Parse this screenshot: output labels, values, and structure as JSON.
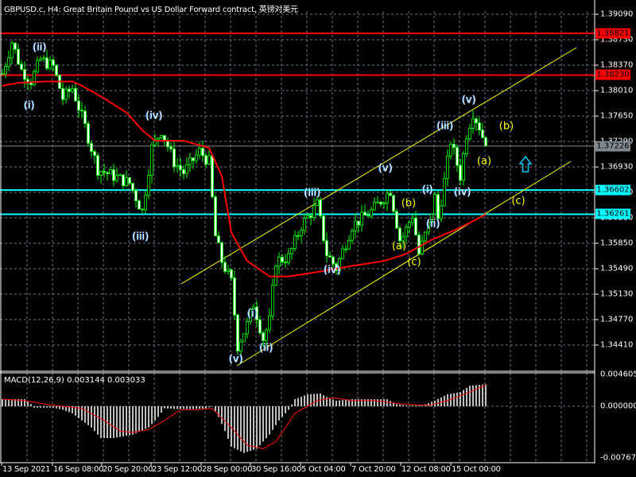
{
  "header": {
    "title": "GBPUSD.c, H4:  Great Britain Pound vs US Dollar Forward contract, 英镑对美元"
  },
  "macd_panel": {
    "title": "MACD(12,26,9) 0.003144 0.003033",
    "axis_labels": [
      "0.004605",
      "0.000000",
      "-0.007678"
    ]
  },
  "price_tags": [
    {
      "value": "1.38821",
      "color": "#ff0000"
    },
    {
      "value": "1.38230",
      "color": "#ff0000"
    },
    {
      "value": "1.37226",
      "color": "#808890"
    },
    {
      "value": "1.36602",
      "color": "#00ffff"
    },
    {
      "value": "1.36261",
      "color": "#00ffff"
    }
  ],
  "wave_labels_white": [
    "(i)",
    "(ii)",
    "(iv)",
    "(iii)",
    "(v)",
    "(i)",
    "(ii)",
    "(iii)",
    "(iv)",
    "(v)",
    "(i)",
    "(ii)",
    "(iii)",
    "(iv)",
    "(v)"
  ],
  "wave_labels_yellow": [
    "(b)",
    "(a)",
    "(c)",
    "(b)",
    "(a)",
    "(c)"
  ],
  "chart_data": {
    "type": "candlestick",
    "symbol": "GBPUSD.c",
    "timeframe": "H4",
    "y_ticks": [
      "1.39090",
      "1.38730",
      "1.38370",
      "1.38010",
      "1.37650",
      "1.37290",
      "1.36930",
      "1.36570",
      "1.36210",
      "1.35850",
      "1.35490",
      "1.35130",
      "1.34770",
      "1.34410"
    ],
    "ylim": [
      1.3393,
      1.3929
    ],
    "x_ticks": [
      "13 Sep 2021",
      "16 Sep 08:00",
      "20 Sep 20:00",
      "23 Sep 12:00",
      "28 Sep 00:00",
      "30 Sep 16:00",
      "5 Oct 04:00",
      "7 Oct 20:00",
      "12 Oct 08:00",
      "15 Oct 00:00"
    ],
    "bars_per_tick": 16,
    "close_waypoints": [
      [
        0,
        1.3825
      ],
      [
        3,
        1.387
      ],
      [
        6,
        1.383
      ],
      [
        9,
        1.3815
      ],
      [
        12,
        1.3845
      ],
      [
        16,
        1.3835
      ],
      [
        19,
        1.379
      ],
      [
        22,
        1.3805
      ],
      [
        26,
        1.375
      ],
      [
        30,
        1.369
      ],
      [
        35,
        1.368
      ],
      [
        40,
        1.367
      ],
      [
        44,
        1.363
      ],
      [
        47,
        1.372
      ],
      [
        50,
        1.3745
      ],
      [
        54,
        1.37
      ],
      [
        57,
        1.3685
      ],
      [
        62,
        1.3715
      ],
      [
        65,
        1.37
      ],
      [
        67,
        1.3595
      ],
      [
        69,
        1.356
      ],
      [
        72,
        1.353
      ],
      [
        74,
        1.344
      ],
      [
        77,
        1.347
      ],
      [
        79,
        1.35
      ],
      [
        82,
        1.345
      ],
      [
        84,
        1.3475
      ],
      [
        86,
        1.356
      ],
      [
        90,
        1.3565
      ],
      [
        94,
        1.361
      ],
      [
        99,
        1.364
      ],
      [
        102,
        1.357
      ],
      [
        105,
        1.355
      ],
      [
        110,
        1.361
      ],
      [
        116,
        1.363
      ],
      [
        122,
        1.366
      ],
      [
        125,
        1.359
      ],
      [
        126,
        1.3595
      ],
      [
        129,
        1.3625
      ],
      [
        131,
        1.357
      ],
      [
        134,
        1.361
      ],
      [
        136,
        1.365
      ],
      [
        137,
        1.362
      ],
      [
        140,
        1.37
      ],
      [
        141,
        1.373
      ],
      [
        144,
        1.368
      ],
      [
        146,
        1.374
      ],
      [
        148,
        1.377
      ],
      [
        150,
        1.375
      ],
      [
        152,
        1.37226
      ]
    ],
    "ma_waypoints": [
      [
        0,
        1.3808
      ],
      [
        5,
        1.3812
      ],
      [
        14,
        1.3814
      ],
      [
        22,
        1.3814
      ],
      [
        25,
        1.3808
      ],
      [
        32,
        1.379
      ],
      [
        39,
        1.377
      ],
      [
        44,
        1.3745
      ],
      [
        48,
        1.373
      ],
      [
        57,
        1.373
      ],
      [
        65,
        1.372
      ],
      [
        69,
        1.368
      ],
      [
        72,
        1.36
      ],
      [
        77,
        1.356
      ],
      [
        84,
        1.3538
      ],
      [
        90,
        1.3538
      ],
      [
        100,
        1.3545
      ],
      [
        110,
        1.3553
      ],
      [
        120,
        1.356
      ],
      [
        127,
        1.357
      ],
      [
        135,
        1.359
      ],
      [
        142,
        1.3603
      ],
      [
        147,
        1.3614
      ],
      [
        152,
        1.3626
      ]
    ],
    "macd_histogram_waypoints": [
      [
        0,
        0.001
      ],
      [
        7,
        0.001
      ],
      [
        9,
        0.0003
      ],
      [
        10,
        -0.0002
      ],
      [
        16,
        -0.0002
      ],
      [
        19,
        -0.0005
      ],
      [
        22,
        -0.001
      ],
      [
        25,
        -0.002
      ],
      [
        28,
        -0.003
      ],
      [
        31,
        -0.0045
      ],
      [
        35,
        -0.0045
      ],
      [
        41,
        -0.004
      ],
      [
        46,
        -0.003
      ],
      [
        49,
        -0.0015
      ],
      [
        51,
        -0.0003
      ],
      [
        55,
        -0.0004
      ],
      [
        60,
        -0.0004
      ],
      [
        64,
        -0.0003
      ],
      [
        66,
        0
      ],
      [
        68,
        -0.0015
      ],
      [
        70,
        -0.0035
      ],
      [
        72,
        -0.0057
      ],
      [
        76,
        -0.0066
      ],
      [
        80,
        -0.006
      ],
      [
        84,
        -0.004
      ],
      [
        87,
        -0.002
      ],
      [
        90,
        -0.0005
      ],
      [
        92,
        0.001
      ],
      [
        96,
        0.0017
      ],
      [
        100,
        0.0018
      ],
      [
        102,
        0.0013
      ],
      [
        105,
        0.0008
      ],
      [
        108,
        0.0009
      ],
      [
        110,
        0.001
      ],
      [
        118,
        0.001
      ],
      [
        121,
        0.001
      ],
      [
        124,
        0.0003
      ],
      [
        127,
        0.0001
      ],
      [
        132,
        0.0001
      ],
      [
        136,
        0.0008
      ],
      [
        140,
        0.0017
      ],
      [
        144,
        0.002
      ],
      [
        147,
        0.0029
      ],
      [
        152,
        0.0031
      ]
    ],
    "macd_signal_waypoints": [
      [
        0,
        0.001
      ],
      [
        7,
        0.0008
      ],
      [
        15,
        0.0002
      ],
      [
        25,
        -0.0003
      ],
      [
        32,
        -0.002
      ],
      [
        37,
        -0.0035
      ],
      [
        41,
        -0.0037
      ],
      [
        46,
        -0.0033
      ],
      [
        51,
        -0.002
      ],
      [
        56,
        -0.0005
      ],
      [
        61,
        -0.0005
      ],
      [
        66,
        -0.0003
      ],
      [
        72,
        -0.003
      ],
      [
        77,
        -0.0055
      ],
      [
        82,
        -0.006
      ],
      [
        86,
        -0.005
      ],
      [
        92,
        -0.001
      ],
      [
        99,
        0.0008
      ],
      [
        104,
        0.0012
      ],
      [
        110,
        0.0008
      ],
      [
        117,
        0.0008
      ],
      [
        126,
        0.0003
      ],
      [
        134,
        0.0001
      ],
      [
        140,
        0.0008
      ],
      [
        147,
        0.002
      ],
      [
        152,
        0.003
      ]
    ],
    "macd_ylim": [
      -0.007678,
      0.004605
    ],
    "horizontal_levels": [
      1.38821,
      1.3823,
      1.37226,
      1.36602,
      1.36261
    ]
  }
}
